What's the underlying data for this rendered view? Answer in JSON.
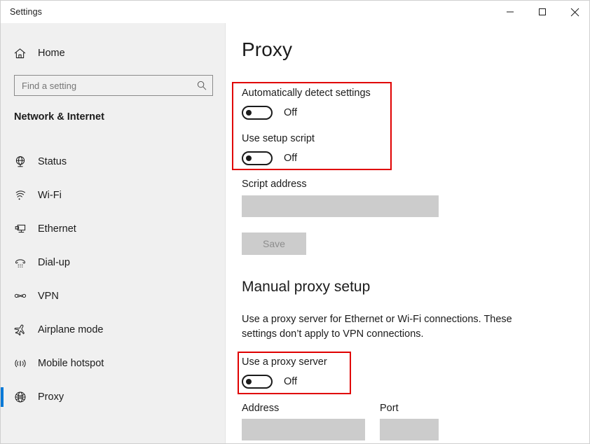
{
  "window": {
    "title": "Settings",
    "controls": {
      "minimize": "minimize",
      "maximize": "maximize",
      "close": "close"
    }
  },
  "sidebar": {
    "home_label": "Home",
    "home_icon": "home-icon",
    "search": {
      "placeholder": "Find a setting",
      "value": "",
      "icon": "search-icon"
    },
    "category": "Network & Internet",
    "items": [
      {
        "label": "Status",
        "icon": "status-globe-icon",
        "selected": false
      },
      {
        "label": "Wi-Fi",
        "icon": "wifi-icon",
        "selected": false
      },
      {
        "label": "Ethernet",
        "icon": "ethernet-icon",
        "selected": false
      },
      {
        "label": "Dial-up",
        "icon": "dialup-phone-icon",
        "selected": false
      },
      {
        "label": "VPN",
        "icon": "vpn-icon",
        "selected": false
      },
      {
        "label": "Airplane mode",
        "icon": "airplane-icon",
        "selected": false
      },
      {
        "label": "Mobile hotspot",
        "icon": "mobile-hotspot-icon",
        "selected": false
      },
      {
        "label": "Proxy",
        "icon": "globe-icon",
        "selected": true
      }
    ]
  },
  "main": {
    "page_title": "Proxy",
    "auto_detect": {
      "label": "Automatically detect settings",
      "state": "Off",
      "on": false
    },
    "setup_script": {
      "label": "Use setup script",
      "state": "Off",
      "on": false
    },
    "script_address": {
      "label": "Script address",
      "value": "",
      "disabled": true
    },
    "save_button": {
      "label": "Save",
      "disabled": true
    },
    "manual_section": {
      "heading": "Manual proxy setup",
      "description": "Use a proxy server for Ethernet or Wi-Fi connections. These settings don’t apply to VPN connections."
    },
    "use_proxy": {
      "label": "Use a proxy server",
      "state": "Off",
      "on": false
    },
    "address_field": {
      "label": "Address",
      "value": "",
      "disabled": true
    },
    "port_field": {
      "label": "Port",
      "value": "",
      "disabled": true
    }
  },
  "annotations": {
    "highlight_color": "#e00000",
    "boxes": [
      {
        "name": "proxy-auto-settings-highlight"
      },
      {
        "name": "use-proxy-server-highlight"
      }
    ]
  },
  "theme": {
    "accent": "#0078d7",
    "sidebar_bg": "#f0f0f0",
    "content_bg": "#ffffff",
    "disabled_bg": "#cccccc",
    "text": "#1b1b1b"
  }
}
